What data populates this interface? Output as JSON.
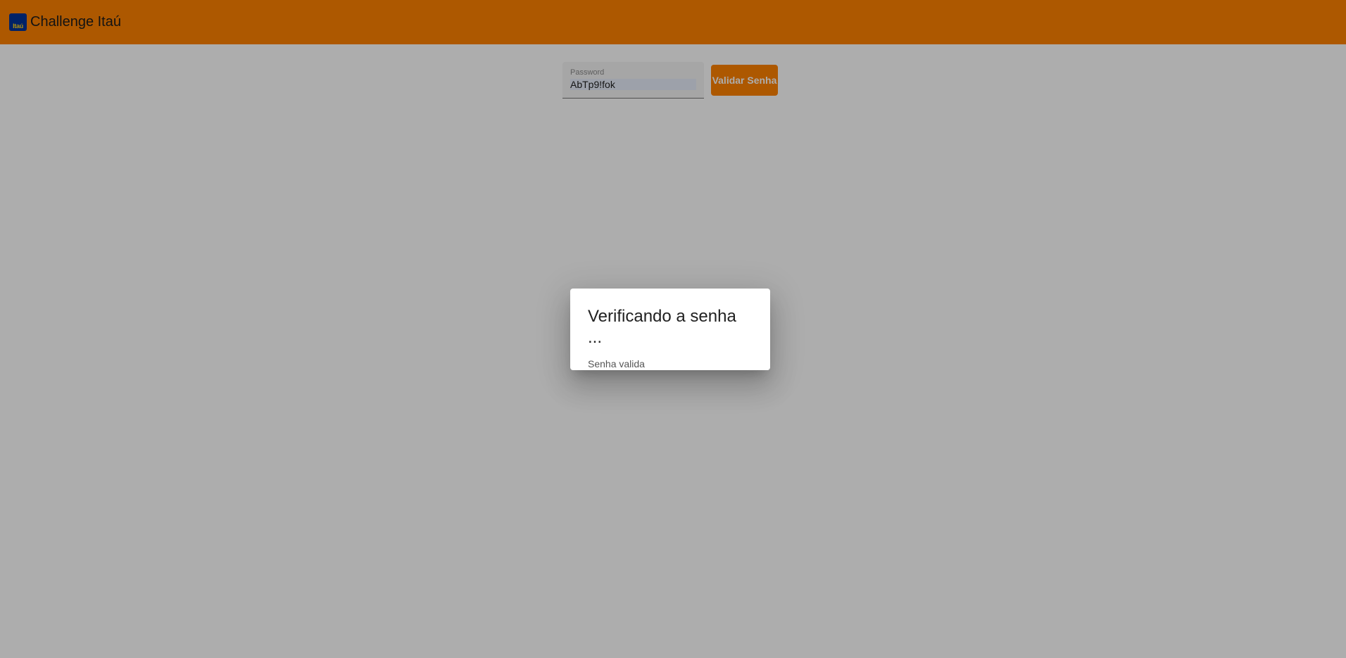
{
  "toolbar": {
    "logo_text": "Itaú",
    "title": "Challenge Itaú",
    "background_color": "#ff8200"
  },
  "form": {
    "password_label": "Password",
    "password_value": "AbTp9!fok",
    "validate_button_label": "Validar Senha"
  },
  "dialog": {
    "title": "Verificando a senha ...",
    "message": "Senha valida"
  }
}
